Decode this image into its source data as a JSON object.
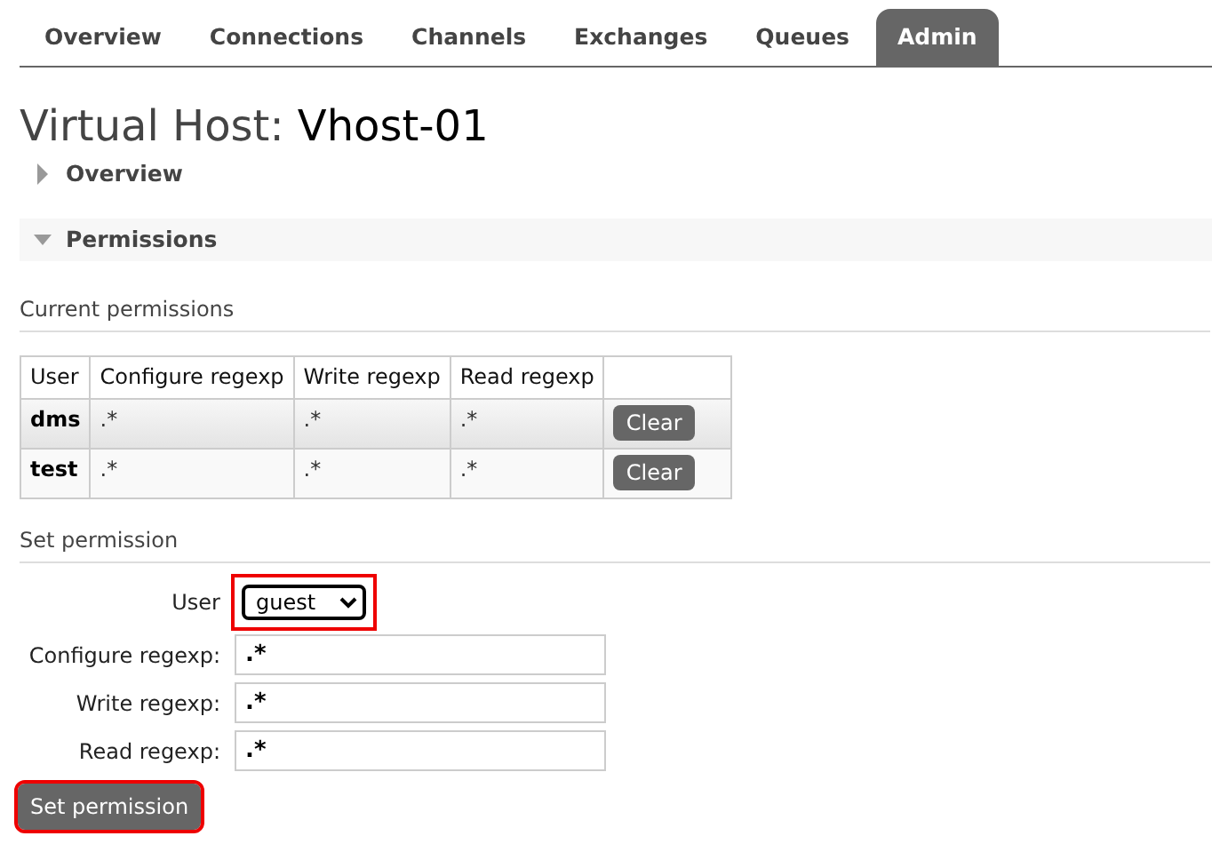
{
  "tabs": [
    {
      "label": "Overview",
      "selected": false
    },
    {
      "label": "Connections",
      "selected": false
    },
    {
      "label": "Channels",
      "selected": false
    },
    {
      "label": "Exchanges",
      "selected": false
    },
    {
      "label": "Queues",
      "selected": false
    },
    {
      "label": "Admin",
      "selected": true
    }
  ],
  "page_title": {
    "prefix": "Virtual Host:",
    "name": "Vhost-01"
  },
  "sections": [
    {
      "label": "Overview",
      "expanded": false
    },
    {
      "label": "Permissions",
      "expanded": true
    }
  ],
  "current_permissions": {
    "heading": "Current permissions",
    "columns": [
      "User",
      "Configure regexp",
      "Write regexp",
      "Read regexp"
    ],
    "rows": [
      {
        "user": "dms",
        "configure": ".*",
        "write": ".*",
        "read": ".*",
        "action": "Clear"
      },
      {
        "user": "test",
        "configure": ".*",
        "write": ".*",
        "read": ".*",
        "action": "Clear"
      }
    ]
  },
  "set_permission": {
    "heading": "Set permission",
    "user_label": "User",
    "user_value": "guest",
    "user_highlighted": true,
    "fields": [
      {
        "label": "Configure regexp:",
        "value": ".*"
      },
      {
        "label": "Write regexp:",
        "value": ".*"
      },
      {
        "label": "Read regexp:",
        "value": ".*"
      }
    ],
    "button": {
      "label": "Set permission",
      "highlighted": true
    }
  }
}
